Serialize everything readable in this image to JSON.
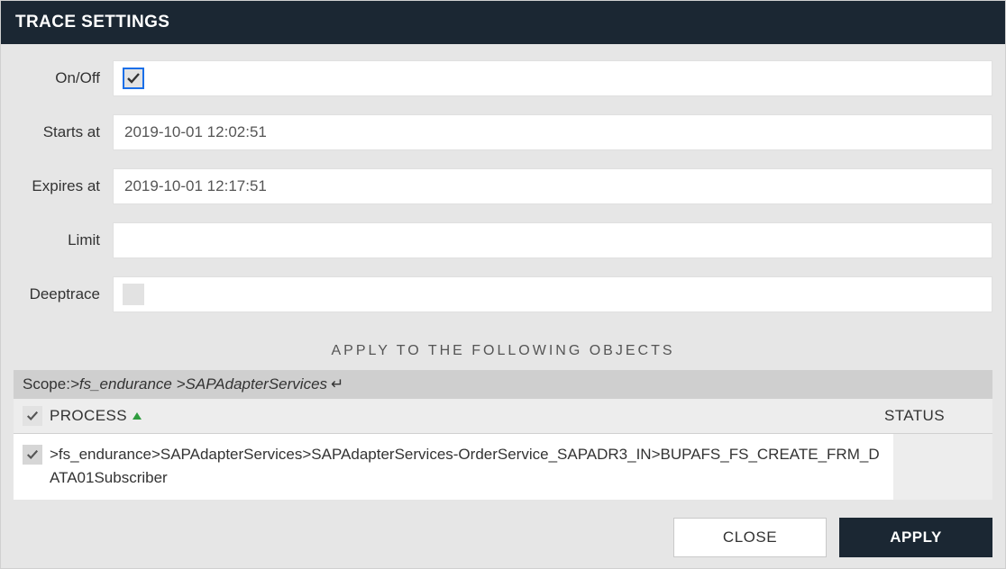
{
  "dialog": {
    "title": "TRACE SETTINGS"
  },
  "form": {
    "onoff": {
      "label": "On/Off",
      "checked": true
    },
    "starts_at": {
      "label": "Starts at",
      "value": "2019-10-01 12:02:51"
    },
    "expires_at": {
      "label": "Expires at",
      "value": "2019-10-01 12:17:51"
    },
    "limit": {
      "label": "Limit",
      "value": ""
    },
    "deeptrace": {
      "label": "Deeptrace",
      "checked": false
    }
  },
  "objects": {
    "section_title": "APPLY TO THE FOLLOWING OBJECTS",
    "scope_label": "Scope: ",
    "scope_path": ">fs_endurance >SAPAdapterServices",
    "return_glyph": "↵",
    "columns": {
      "process": "PROCESS",
      "status": "STATUS"
    },
    "rows": [
      {
        "checked": true,
        "process": ">fs_endurance>SAPAdapterServices>SAPAdapterServices-OrderService_SAPADR3_IN>BUPAFS_FS_CREATE_FRM_DATA01Subscriber",
        "status": ""
      }
    ]
  },
  "buttons": {
    "close": "CLOSE",
    "apply": "APPLY"
  },
  "colors": {
    "header_bg": "#1b2733",
    "accent": "#1a6fe8",
    "sort_asc": "#2e9c3e"
  }
}
